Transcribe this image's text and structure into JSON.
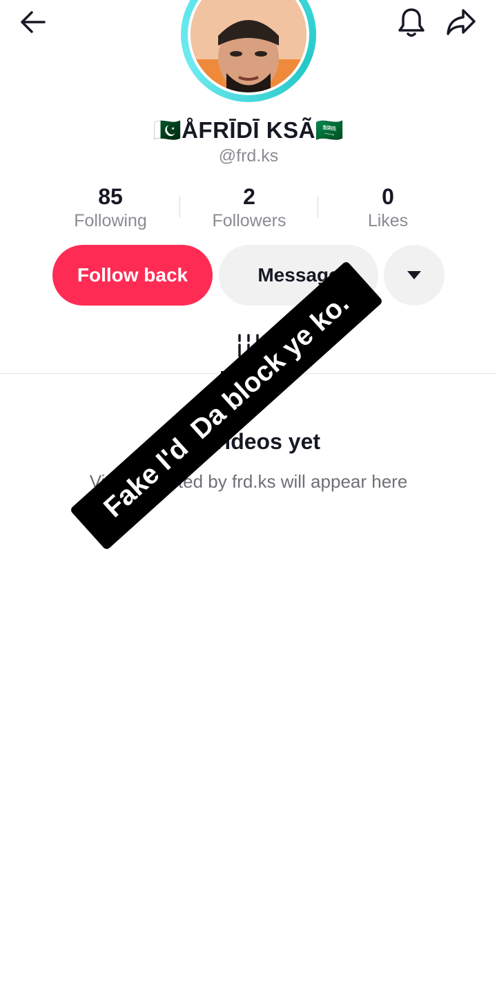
{
  "profile": {
    "display_name": "🇵🇰ÅFRĪDĪ KSÃ🇸🇦",
    "username": "@frd.ks"
  },
  "stats": {
    "following": {
      "value": "85",
      "label": "Following"
    },
    "followers": {
      "value": "2",
      "label": "Followers"
    },
    "likes": {
      "value": "0",
      "label": "Likes"
    }
  },
  "actions": {
    "follow_back": "Follow back",
    "message": "Message"
  },
  "empty_state": {
    "title": "No videos yet",
    "subtitle": "Videos posted by frd.ks will appear here"
  },
  "overlay": {
    "text": "Fake I'd  Da block ye ko."
  },
  "colors": {
    "accent": "#fe2c55",
    "ring": "#4de1e6",
    "secondary_button": "#f1f1f2"
  },
  "icons": {
    "back": "arrow-left-icon",
    "notifications": "bell-icon",
    "share": "share-arrow-icon",
    "more": "caret-down-icon",
    "videos_tab": "grid-icon"
  }
}
